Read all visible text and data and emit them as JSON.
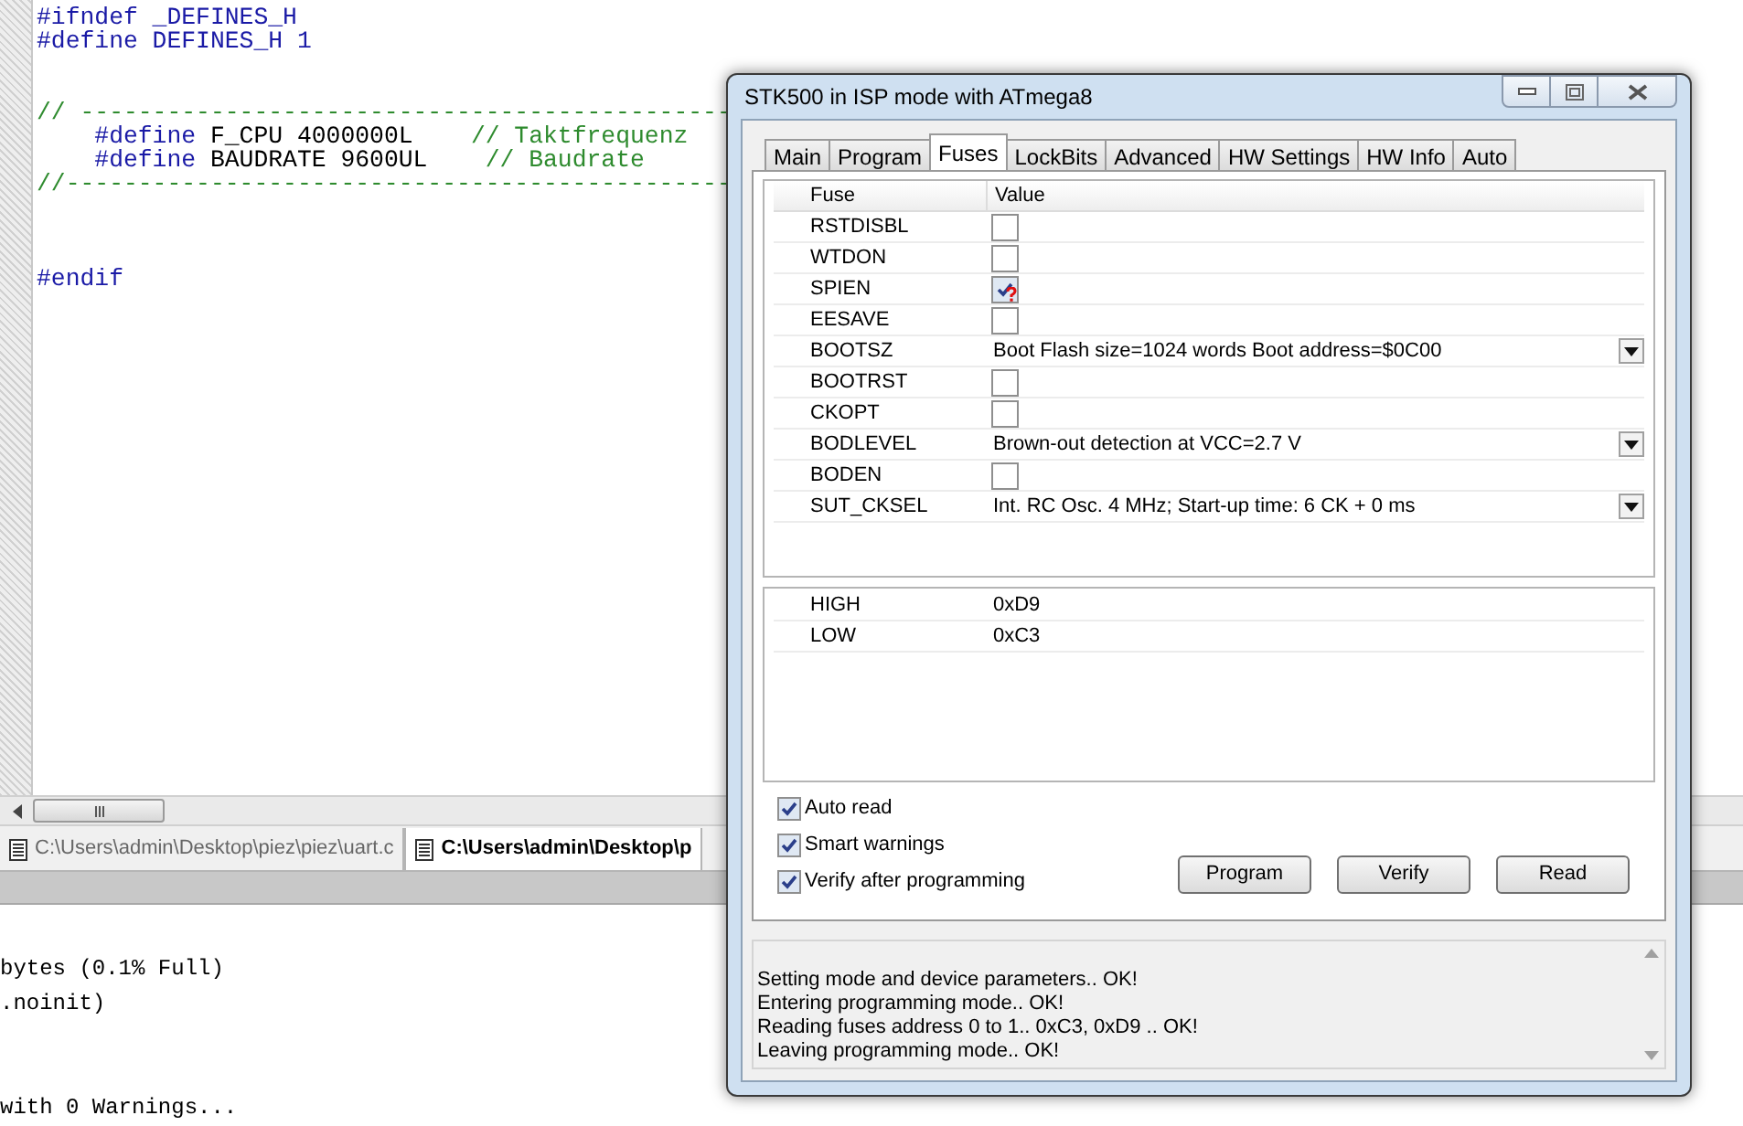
{
  "editor": {
    "lines": [
      {
        "kind": "code",
        "segments": [
          {
            "kind": "directive",
            "text": "#ifndef _DEFINES_H"
          }
        ]
      },
      {
        "kind": "code",
        "segments": [
          {
            "kind": "directive",
            "text": "#define DEFINES_H 1"
          }
        ]
      },
      {
        "kind": "blank"
      },
      {
        "kind": "blank"
      },
      {
        "kind": "code",
        "segments": [
          {
            "kind": "comment",
            "text": "// ---------------------------------------------"
          }
        ]
      },
      {
        "kind": "code",
        "segments": [
          {
            "kind": "directive",
            "text": "    #define"
          },
          {
            "kind": "plain",
            "text": " F_CPU 4000000L    "
          },
          {
            "kind": "comment",
            "text": "// Taktfrequenz"
          }
        ]
      },
      {
        "kind": "code",
        "segments": [
          {
            "kind": "directive",
            "text": "    #define"
          },
          {
            "kind": "plain",
            "text": " BAUDRATE 9600UL    "
          },
          {
            "kind": "comment",
            "text": "// Baudrate"
          }
        ]
      },
      {
        "kind": "code",
        "segments": [
          {
            "kind": "comment",
            "text": "//----------------------------------------------"
          }
        ]
      },
      {
        "kind": "blank"
      },
      {
        "kind": "blank"
      },
      {
        "kind": "blank"
      },
      {
        "kind": "code",
        "segments": [
          {
            "kind": "directive",
            "text": "#endif"
          }
        ]
      }
    ],
    "tabs": [
      {
        "label": "C:\\Users\\admin\\Desktop\\piez\\piez\\uart.c",
        "selected": false
      },
      {
        "label": "C:\\Users\\admin\\Desktop\\p",
        "selected": true
      }
    ]
  },
  "output": {
    "lines": [
      {
        "kind": "text",
        "text": "bytes (0.1% Full)"
      },
      {
        "kind": "text",
        "text": ".noinit)"
      },
      {
        "kind": "blank"
      },
      {
        "kind": "blank"
      },
      {
        "kind": "text",
        "text": "with 0 Warnings..."
      }
    ]
  },
  "dialog": {
    "title": "STK500 in ISP mode with ATmega8",
    "tabs": [
      {
        "label": "Main",
        "selected": false
      },
      {
        "label": "Program",
        "selected": false
      },
      {
        "label": "Fuses",
        "selected": true
      },
      {
        "label": "LockBits",
        "selected": false
      },
      {
        "label": "Advanced",
        "selected": false
      },
      {
        "label": "HW Settings",
        "selected": false
      },
      {
        "label": "HW Info",
        "selected": false
      },
      {
        "label": "Auto",
        "selected": false
      }
    ],
    "fuse_table": {
      "columns": [
        "Fuse",
        "Value"
      ],
      "rows": [
        {
          "name": "RSTDISBL",
          "kind": "checkbox",
          "checked": false,
          "warning": false
        },
        {
          "name": "WTDON",
          "kind": "checkbox",
          "checked": false,
          "warning": false
        },
        {
          "name": "SPIEN",
          "kind": "checkbox",
          "checked": true,
          "warning": true
        },
        {
          "name": "EESAVE",
          "kind": "checkbox",
          "checked": false,
          "warning": false
        },
        {
          "name": "BOOTSZ",
          "kind": "select",
          "value": "Boot Flash size=1024 words Boot address=$0C00"
        },
        {
          "name": "BOOTRST",
          "kind": "checkbox",
          "checked": false,
          "warning": false
        },
        {
          "name": "CKOPT",
          "kind": "checkbox",
          "checked": false,
          "warning": false
        },
        {
          "name": "BODLEVEL",
          "kind": "select",
          "value": "Brown-out detection at VCC=2.7 V"
        },
        {
          "name": "BODEN",
          "kind": "checkbox",
          "checked": false,
          "warning": false
        },
        {
          "name": "SUT_CKSEL",
          "kind": "select",
          "value": "Int. RC Osc. 4 MHz; Start-up time: 6 CK + 0 ms"
        }
      ]
    },
    "fuse_bytes": [
      {
        "name": "HIGH",
        "value": "0xD9"
      },
      {
        "name": "LOW",
        "value": "0xC3"
      }
    ],
    "options": [
      {
        "label": "Auto read",
        "checked": true
      },
      {
        "label": "Smart warnings",
        "checked": true
      },
      {
        "label": "Verify after programming",
        "checked": true
      }
    ],
    "buttons": [
      "Program",
      "Verify",
      "Read"
    ],
    "log": [
      "Setting mode and device parameters.. OK!",
      "Entering programming mode.. OK!",
      "Reading fuses address 0 to 1.. 0xC3, 0xD9 .. OK!",
      "Leaving programming mode.. OK!"
    ]
  }
}
